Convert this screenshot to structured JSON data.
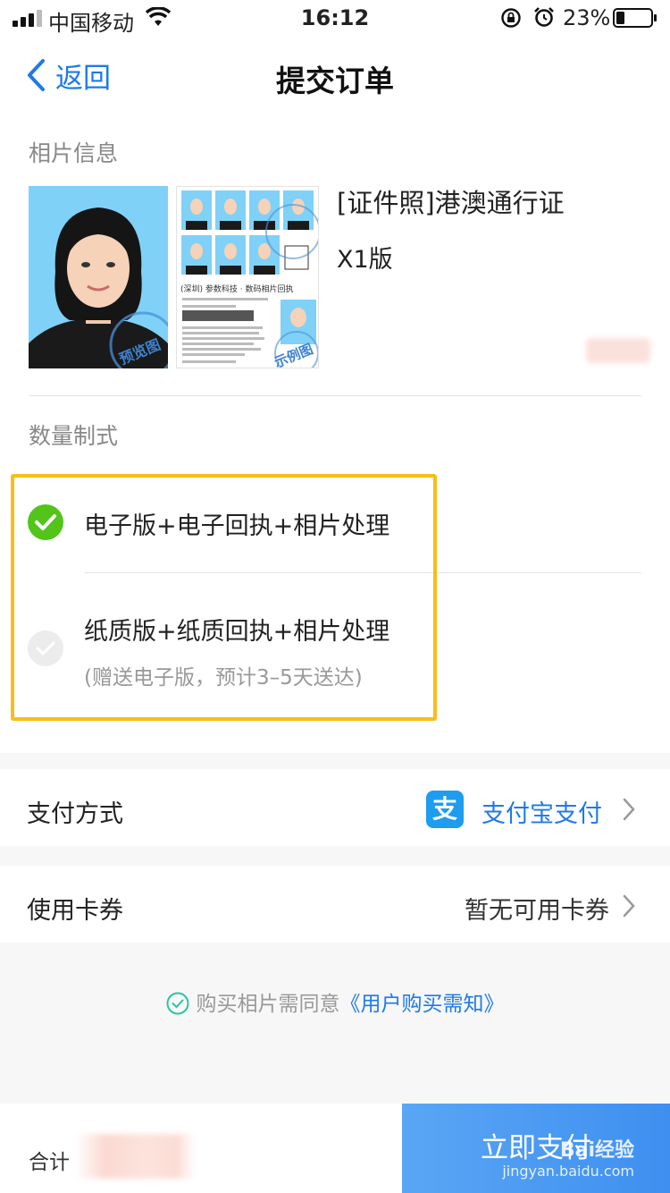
{
  "status_bar": {
    "carrier": "中国移动",
    "time": "16:12",
    "battery": "23%"
  },
  "nav": {
    "back_label": "返回",
    "title": "提交订单"
  },
  "photo_info": {
    "section_label": "相片信息",
    "preview_stamp": "预览图",
    "sample_stamp": "示例图",
    "sheet_caption": "(深圳) 参数科技 · 数码相片回执",
    "product_name": "[证件照]港澳通行证",
    "version": "X1版"
  },
  "quantity": {
    "section_label": "数量制式",
    "options": [
      {
        "label": "电子版+电子回执+相片处理",
        "selected": true
      },
      {
        "label": "纸质版+纸质回执+相片处理",
        "note": "(赠送电子版，预计3–5天送达)",
        "selected": false
      }
    ]
  },
  "payment": {
    "label": "支付方式",
    "value": "支付宝支付",
    "icon": "alipay-icon",
    "icon_glyph": "支"
  },
  "coupon": {
    "label": "使用卡券",
    "value": "暂无可用卡券"
  },
  "agreement": {
    "text": "购买相片需同意",
    "link": "《用户购买需知》"
  },
  "bottom": {
    "total_label": "合计",
    "pay_button": "立即支付"
  },
  "watermark": {
    "brand": "Bai经验",
    "url": "jingyan.baidu.com"
  },
  "colors": {
    "accent_blue": "#1e7ae6",
    "check_green": "#52c41a",
    "highlight_yellow": "#f9bd1a",
    "pay_button": "#4a97f2"
  }
}
